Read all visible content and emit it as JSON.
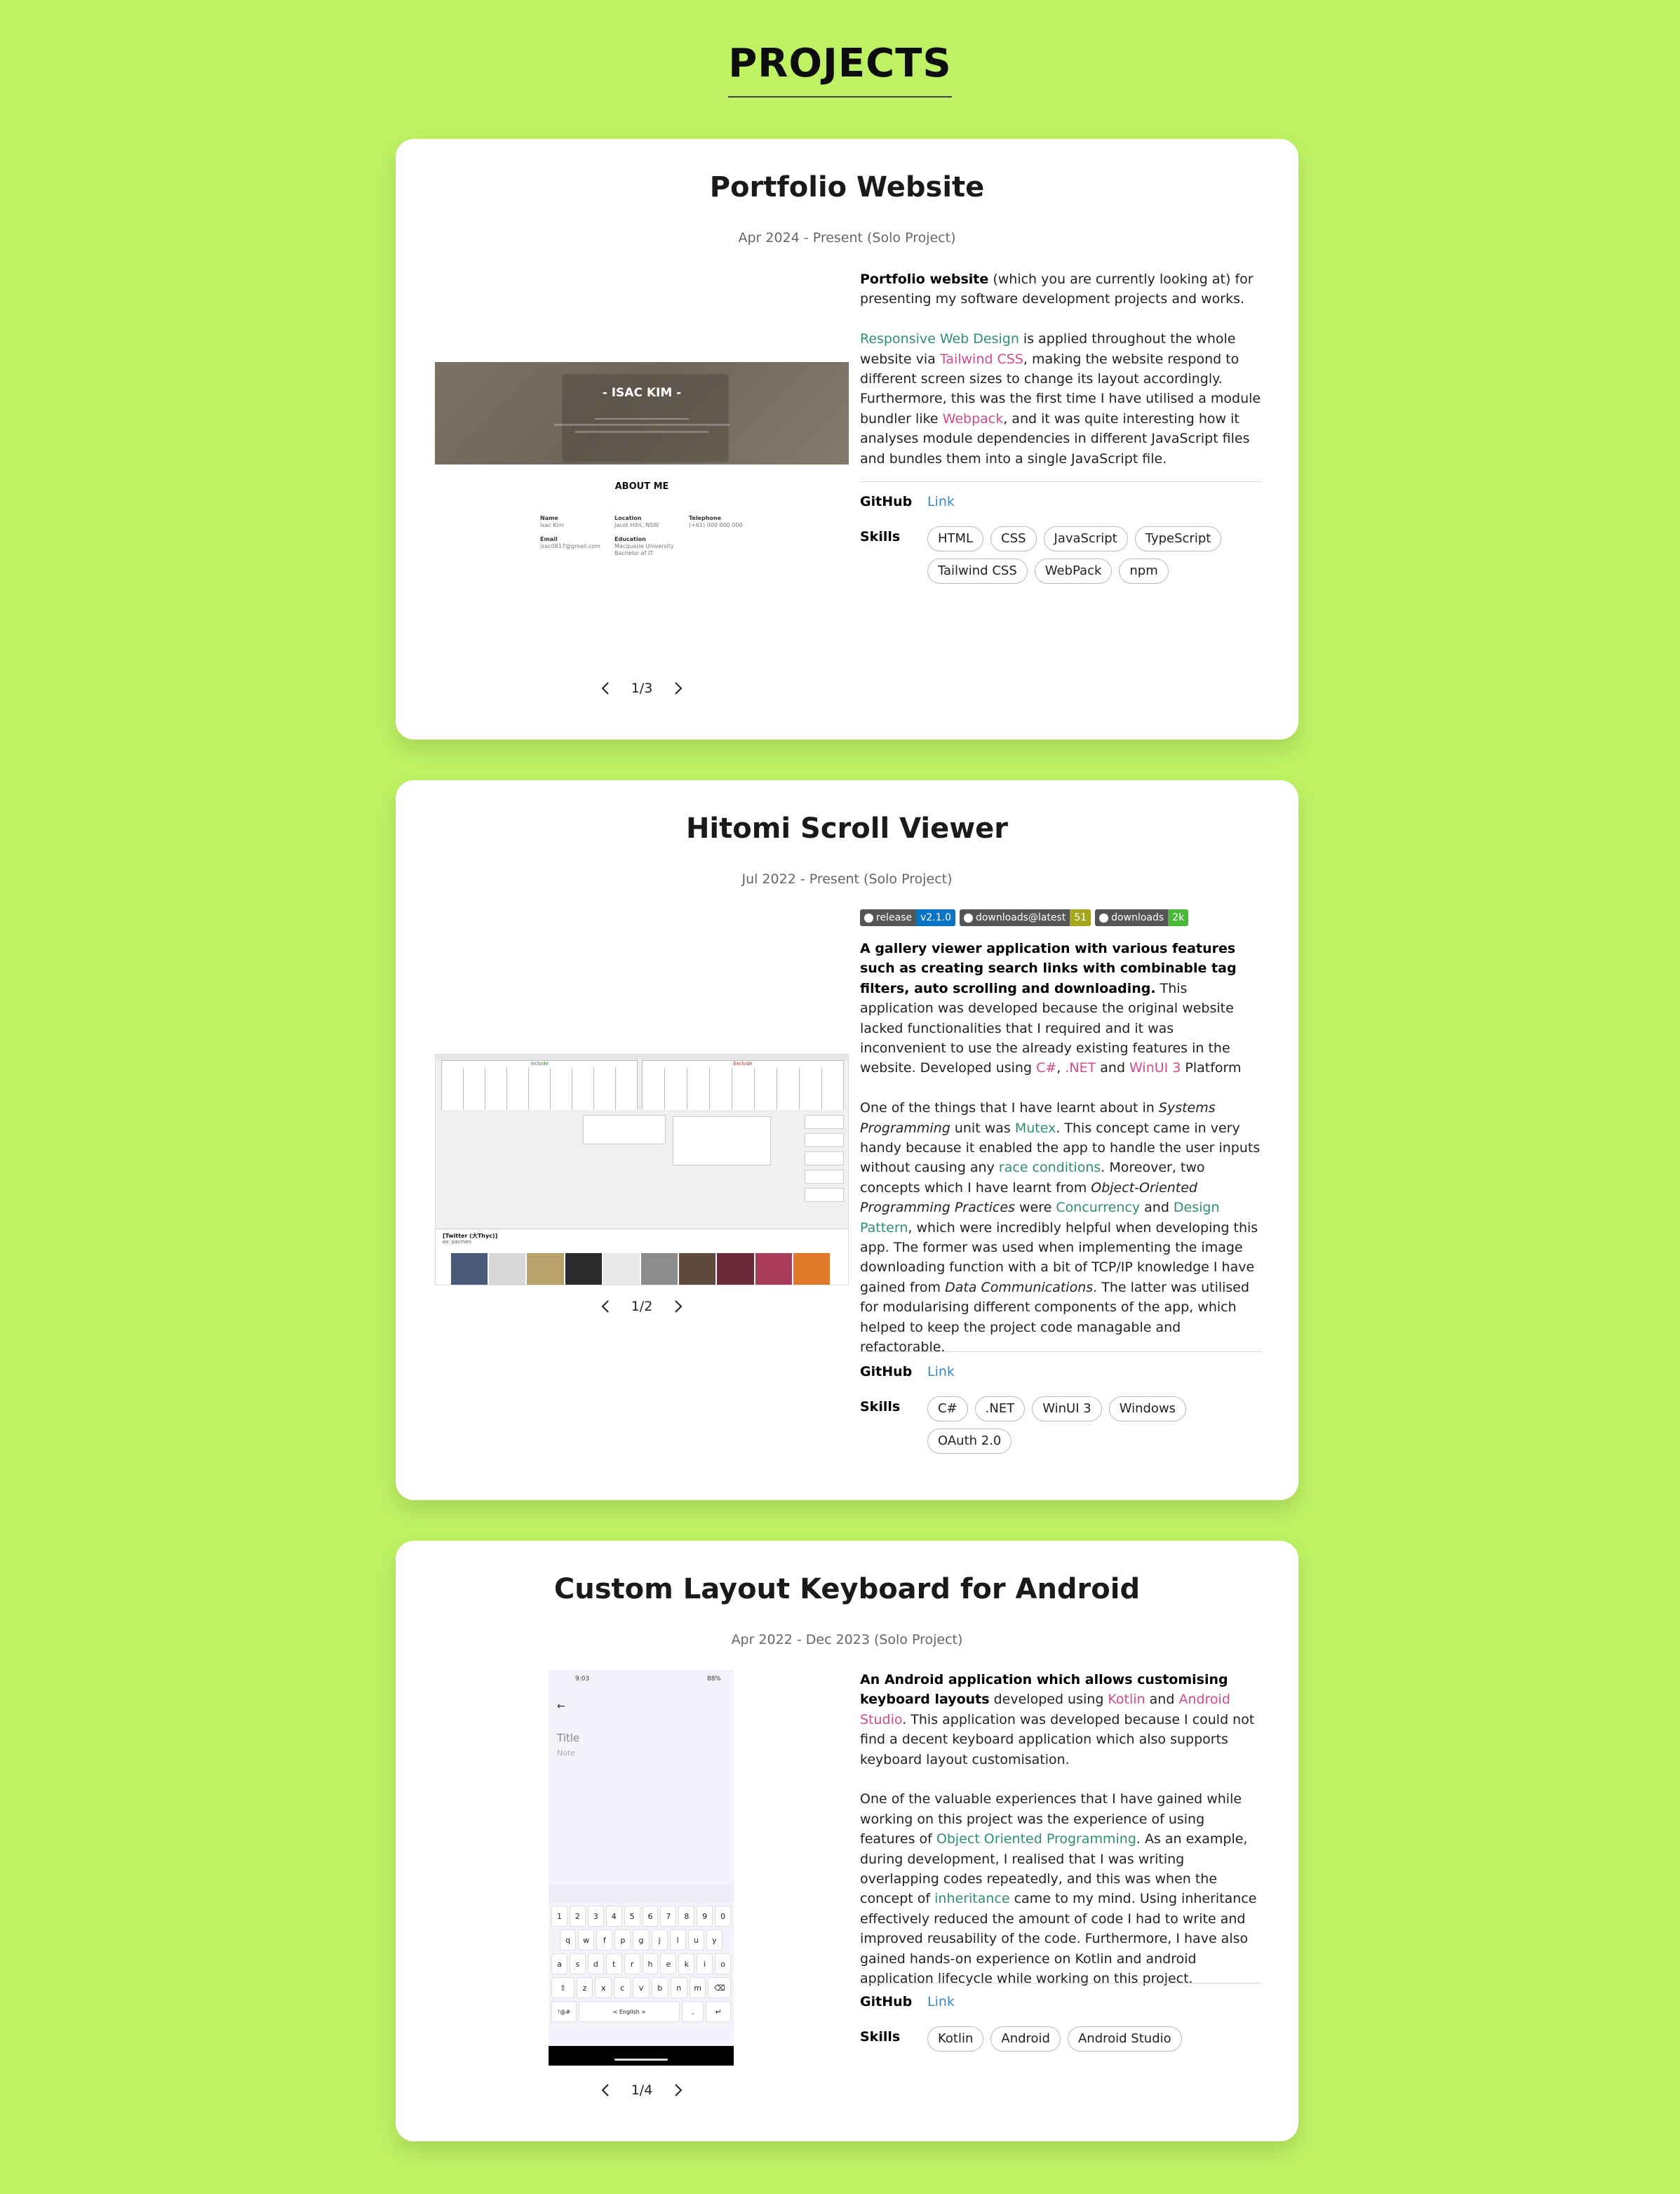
{
  "page": {
    "title": "PROJECTS"
  },
  "projects": [
    {
      "title": "Portfolio Website",
      "date": "Apr 2024 - Present (Solo Project)",
      "desc1_bold": "Portfolio website",
      "desc1_rest": " (which you are currently looking at) for presenting my software development projects and works.",
      "desc2_parts": [
        "Responsive Web Design",
        " is applied throughout the whole website via ",
        "Tailwind CSS",
        ", making the website respond to different screen sizes to change its layout accordingly. Furthermore, this was the first time I have utilised a module bundler like ",
        "Webpack",
        ", and it was quite interesting how it analyses module dependencies in different JavaScript files and bundles them into a single JavaScript file."
      ],
      "github_label": "GitHub",
      "github_link": "Link",
      "skills_label": "Skills",
      "skills": [
        "HTML",
        "CSS",
        "JavaScript",
        "TypeScript",
        "Tailwind CSS",
        "WebPack",
        "npm"
      ],
      "pager": "1/3",
      "preview": {
        "hero_name": "- ISAC KIM -",
        "about_title": "ABOUT ME",
        "fields": [
          {
            "label": "Name",
            "value": "Isac Kim"
          },
          {
            "label": "Location",
            "value": "Jacot Hills, NSW"
          },
          {
            "label": "Telephone",
            "value": "(+61) 000 000 000"
          },
          {
            "label": "Email",
            "value": "isac0817@gmail.com"
          },
          {
            "label": "Education",
            "value": "Macquarie University Bachelor of IT"
          }
        ]
      }
    },
    {
      "title": "Hitomi Scroll Viewer",
      "date": "Jul 2022 - Present (Solo Project)",
      "badges": [
        {
          "label": "release",
          "value": "v2.1.0",
          "color": "#0a74c4"
        },
        {
          "label": "downloads@latest",
          "value": "51",
          "color": "#a4a61d"
        },
        {
          "label": "downloads",
          "value": "2k",
          "color": "#4ab73a"
        }
      ],
      "desc1_bold": "A gallery viewer application with various features such as creating search links with combinable tag filters, auto scrolling and downloading.",
      "desc1_parts": [
        " This application was developed because the original website lacked functionalities that I required and it was inconvenient to use the already existing features in the website. Developed using ",
        "C#",
        ", ",
        ".NET",
        " and ",
        "WinUI 3",
        " Platform"
      ],
      "desc2_parts": [
        "One of the things that I have learnt about in ",
        "Systems Programming",
        " unit was ",
        "Mutex",
        ". This concept came in very handy because it enabled the app to handle the user inputs without causing any ",
        "race conditions",
        ". Moreover, two concepts which I have learnt from ",
        "Object-Oriented Programming Practices",
        " were ",
        "Concurrency",
        " and ",
        "Design Pattern",
        ", which were incredibly helpful when developing this app. The former was used when implementing the image downloading function with a bit of TCP/IP knowledge I have gained from ",
        "Data Communications",
        ". The latter was utilised for modularising different components of the app, which helped to keep the project code managable and refactorable."
      ],
      "github_label": "GitHub",
      "github_link": "Link",
      "skills_label": "Skills",
      "skills": [
        "C#",
        ".NET",
        "WinUI 3",
        "Windows",
        "OAuth 2.0"
      ],
      "pager": "1/2",
      "preview": {
        "left_header": "Include",
        "right_header": "Exclude",
        "bottom_title": "[Twitter (大Thyc)]",
        "bottom_sub": "ex: pacmen"
      }
    },
    {
      "title": "Custom Layout Keyboard for Android",
      "date": "Apr 2022 - Dec 2023 (Solo Project)",
      "desc1_bold": "An Android application which allows customising keyboard layouts",
      "desc1_parts": [
        " developed using ",
        "Kotlin",
        " and ",
        "Android Studio",
        ". This application was developed because I could not find a decent keyboard application which also supports keyboard layout customisation."
      ],
      "desc2_parts": [
        "One of the valuable experiences that I have gained while working on this project was the experience of using features of ",
        "Object Oriented Programming",
        ". As an example, during development, I realised that I was writing overlapping codes repeatedly, and this was when the concept of ",
        "inheritance",
        " came to my mind. Using inheritance effectively reduced the amount of code I had to write and improved reusability of the code. Furthermore, I have also gained hands-on experience on Kotlin and android application lifecycle while working on this project."
      ],
      "github_label": "GitHub",
      "github_link": "Link",
      "skills_label": "Skills",
      "skills": [
        "Kotlin",
        "Android",
        "Android Studio"
      ],
      "pager": "1/4",
      "preview": {
        "status_time": "9:03",
        "battery": "88%",
        "title_placeholder": "Title",
        "note_placeholder": "Note",
        "row_numbers": [
          "1",
          "2",
          "3",
          "4",
          "5",
          "6",
          "7",
          "8",
          "9",
          "0"
        ],
        "row_1": [
          "q",
          "w",
          "f",
          "p",
          "g",
          "j",
          "l",
          "u",
          "y"
        ],
        "row_2": [
          "a",
          "s",
          "d",
          "t",
          "r",
          "h",
          "e",
          "k",
          "i",
          "o"
        ],
        "row_3": [
          "z",
          "x",
          "c",
          "v",
          "b",
          "n",
          "m"
        ],
        "symbols_key": "!@#",
        "space_label": "< English >"
      }
    }
  ]
}
